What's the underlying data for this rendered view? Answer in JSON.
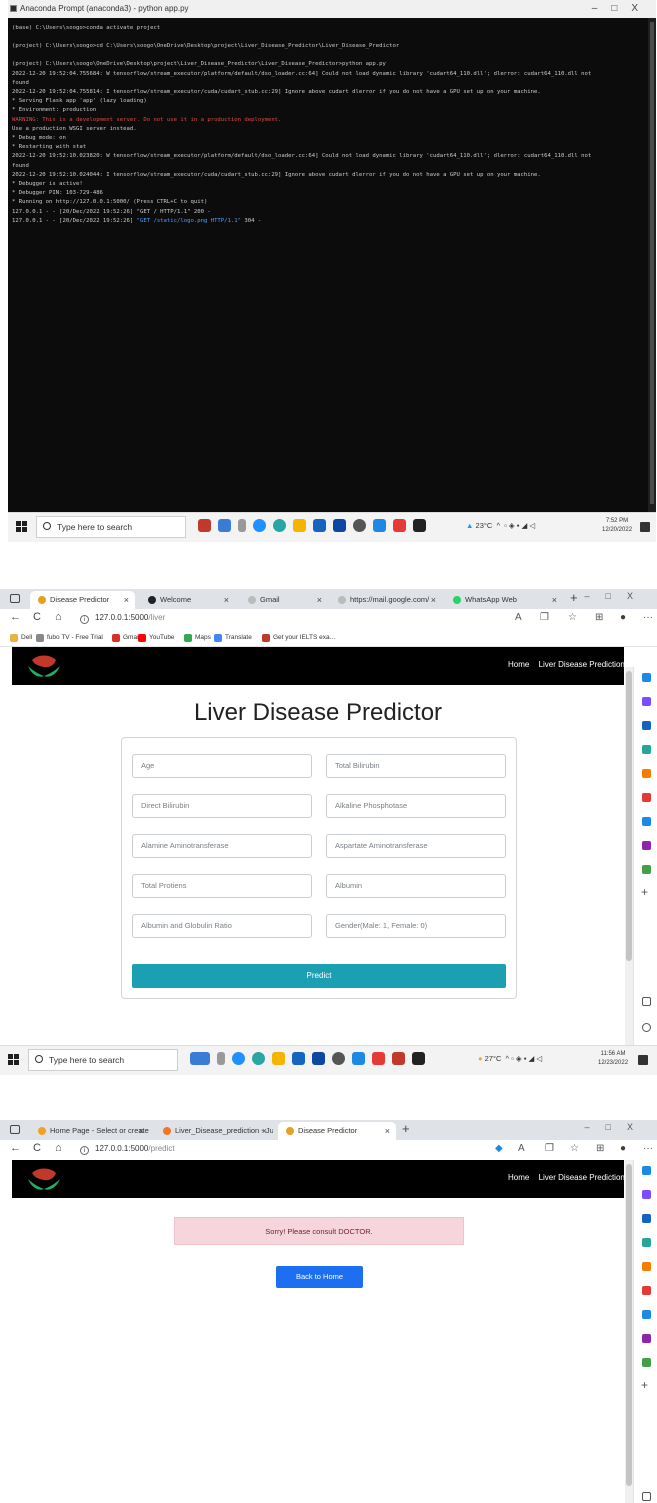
{
  "terminal": {
    "title": "Anaconda Prompt (anaconda3) - python  app.py",
    "lines": [
      {
        "t": "(base) C:\\Users\\soogo>conda activate project",
        "c": ""
      },
      {
        "t": "",
        "c": "gap"
      },
      {
        "t": "(project) C:\\Users\\soogo>cd C:\\Users\\soogo\\OneDrive\\Desktop\\project\\Liver_Disease_Predictor\\Liver_Disease_Predictor",
        "c": ""
      },
      {
        "t": "",
        "c": "gap"
      },
      {
        "t": "(project) C:\\Users\\soogo\\OneDrive\\Desktop\\project\\Liver_Disease_Predictor\\Liver_Disease_Predictor>python app.py",
        "c": ""
      },
      {
        "t": "2022-12-20 19:52:04.755684: W tensorflow/stream_executor/platform/default/dso_loader.cc:64] Could not load dynamic library 'cudart64_110.dll'; dlerror: cudart64_110.dll not",
        "c": ""
      },
      {
        "t": " found",
        "c": ""
      },
      {
        "t": "2022-12-20 19:52:04.755814: I tensorflow/stream_executor/cuda/cudart_stub.cc:29] Ignore above cudart dlerror if you do not have a GPU set up on your machine.",
        "c": ""
      },
      {
        "t": " * Serving Flask app 'app' (lazy loading)",
        "c": ""
      },
      {
        "t": " * Environment: production",
        "c": ""
      },
      {
        "t": "   WARNING: This is a development server. Do not use it in a production deployment.",
        "c": "red"
      },
      {
        "t": "   Use a production WSGI server instead.",
        "c": ""
      },
      {
        "t": " * Debug mode: on",
        "c": ""
      },
      {
        "t": " * Restarting with stat",
        "c": ""
      },
      {
        "t": "2022-12-20 19:52:10.023820: W tensorflow/stream_executor/platform/default/dso_loader.cc:64] Could not load dynamic library 'cudart64_110.dll'; dlerror: cudart64_110.dll not",
        "c": ""
      },
      {
        "t": " found",
        "c": ""
      },
      {
        "t": "2022-12-20 19:52:10.024044: I tensorflow/stream_executor/cuda/cudart_stub.cc:29] Ignore above cudart dlerror if you do not have a GPU set up on your machine.",
        "c": ""
      },
      {
        "t": " * Debugger is active!",
        "c": ""
      },
      {
        "t": " * Debugger PIN: 103-729-486",
        "c": ""
      },
      {
        "t": " * Running on http://127.0.0.1:5000/ (Press CTRL+C to quit)",
        "c": ""
      },
      {
        "t": "127.0.0.1 - - [20/Dec/2022 19:52:26] \"GET / HTTP/1.1\" 200 -",
        "c": ""
      },
      {
        "t": "127.0.0.1 - - [20/Dec/2022 19:52:26] \"GET /static/logo.png HTTP/1.1\" 304 -",
        "c": "mixed"
      }
    ],
    "log_blue_part": "\"GET /static/logo.png HTTP/1.1\"",
    "log_prefix": "127.0.0.1 - - [20/Dec/2022 19:52:26] ",
    "log_suffix": " 304 -"
  },
  "taskbar1": {
    "search_placeholder": "Type here to search",
    "weather": "23°C",
    "time": "7:52 PM",
    "date": "12/20/2022"
  },
  "browser1": {
    "tabs": [
      {
        "label": "Disease Predictor",
        "color": "#e8a020"
      },
      {
        "label": "Welcome",
        "color": "#222222"
      },
      {
        "label": "Gmail",
        "color": "#bbbbbb"
      },
      {
        "label": "https://mail.google.com/",
        "color": "#bbbbbb"
      },
      {
        "label": "WhatsApp Web",
        "color": "#25d366"
      }
    ],
    "url_host": "127.0.0.1:5000",
    "url_path": "/liver",
    "bookmarks": [
      {
        "label": "Dell",
        "color": "#e8b340"
      },
      {
        "label": "fubo TV - Free Trial",
        "color": "#888888"
      },
      {
        "label": "Gmail",
        "color": "#d93025"
      },
      {
        "label": "YouTube",
        "color": "#ff0000"
      },
      {
        "label": "Maps",
        "color": "#34a853"
      },
      {
        "label": "Translate",
        "color": "#4285f4"
      },
      {
        "label": "Get your IELTS exa...",
        "color": "#c0392b"
      }
    ]
  },
  "site": {
    "nav_home": "Home",
    "nav_predict": "Liver Disease Prediction",
    "page_title": "Liver Disease Predictor",
    "fields": [
      "Age",
      "Total Bilirubin",
      "Direct Bilirubin",
      "Alkaline Phosphotase",
      "Alamine Aminotransferase",
      "Aspartate Aminotransferase",
      "Total Protiens",
      "Albumin",
      "Albumin and Globulin Ratio",
      "Gender(Male: 1, Female: 0)"
    ],
    "predict_label": "Predict",
    "alert_text": "Sorry! Please consult DOCTOR.",
    "back_label": "Back to Home"
  },
  "taskbar2": {
    "search_placeholder": "Type here to search",
    "weather": "27°C",
    "time": "11:56 AM",
    "date": "12/23/2022"
  },
  "browser2": {
    "tabs": [
      {
        "label": "Home Page - Select or create a",
        "color": "#f4a020"
      },
      {
        "label": "Liver_Disease_prediction - Jupyt",
        "color": "#f37626"
      },
      {
        "label": "Disease Predictor",
        "color": "#e8a020"
      }
    ],
    "url_host": "127.0.0.1:5000",
    "url_path": "/predict"
  },
  "colors": {
    "terminal_bg": "#0c0c0c",
    "navbar_bg": "#000000",
    "predict_btn": "#1a9fb3",
    "back_btn": "#1b6ff0",
    "alert_bg": "#f6d6dc"
  }
}
